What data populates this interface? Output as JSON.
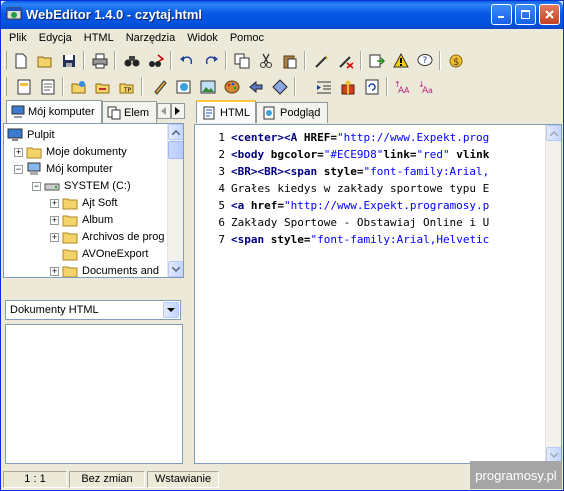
{
  "window": {
    "title": "WebEditor 1.4.0 - czytaj.html"
  },
  "menu": [
    "Plik",
    "Edycja",
    "HTML",
    "Narzędzia",
    "Widok",
    "Pomoc"
  ],
  "left_tabs": {
    "computer": "Mój komputer",
    "elements": "Elem"
  },
  "tree": [
    {
      "label": "Pulpit",
      "icon": "desktop-icon"
    },
    {
      "label": "Moje dokumenty",
      "icon": "folder-icon"
    },
    {
      "label": "Mój komputer",
      "icon": "computer-icon"
    },
    {
      "label": "SYSTEM (C:)",
      "icon": "drive-icon"
    },
    {
      "label": "Ajt Soft",
      "icon": "folder-icon"
    },
    {
      "label": "Album",
      "icon": "folder-icon"
    },
    {
      "label": "Archivos de prog",
      "icon": "folder-icon"
    },
    {
      "label": "AVOneExport",
      "icon": "folder-icon"
    },
    {
      "label": "Documents and",
      "icon": "folder-icon"
    }
  ],
  "file_filter": {
    "selected": "Dokumenty HTML"
  },
  "editor_tabs": {
    "html": "HTML",
    "preview": "Podgląd"
  },
  "code_lines": [
    {
      "num": "1",
      "parts": [
        [
          "tag",
          "<center><A "
        ],
        [
          "attr",
          "HREF="
        ],
        [
          "val",
          "\"http://www.Expekt.prog"
        ]
      ]
    },
    {
      "num": "2",
      "parts": [
        [
          "tag",
          "<body "
        ],
        [
          "attr",
          "bgcolor="
        ],
        [
          "val",
          "\"#ECE9D8\""
        ],
        [
          "attr",
          "link="
        ],
        [
          "val",
          "\"red\""
        ],
        [
          "attr",
          " vlink"
        ]
      ]
    },
    {
      "num": "3",
      "parts": [
        [
          "tag",
          "<BR><BR><span "
        ],
        [
          "attr",
          "style="
        ],
        [
          "val",
          "\"font-family:Arial,"
        ]
      ]
    },
    {
      "num": "4",
      "parts": [
        [
          "txt",
          "Grałes kiedys w zakłady sportowe typu E"
        ]
      ]
    },
    {
      "num": "5",
      "parts": [
        [
          "tag",
          "<a "
        ],
        [
          "attr",
          "href="
        ],
        [
          "val",
          "\"http://www.Expekt.programosy.p"
        ]
      ]
    },
    {
      "num": "6",
      "parts": [
        [
          "txt",
          "Zakłady Sportowe - Obstawiaj Online i U"
        ]
      ]
    },
    {
      "num": "7",
      "parts": [
        [
          "tag",
          "<span "
        ],
        [
          "attr",
          "style="
        ],
        [
          "val",
          "\"font-family:Arial,Helvetic"
        ]
      ]
    }
  ],
  "status": {
    "position": "1 : 1",
    "modified": "Bez zmian",
    "mode": "Wstawianie"
  },
  "watermark": "programosy.pl",
  "colors": {
    "titlebar": "#0558E6",
    "tag": "#000080",
    "value": "#0000FF"
  }
}
